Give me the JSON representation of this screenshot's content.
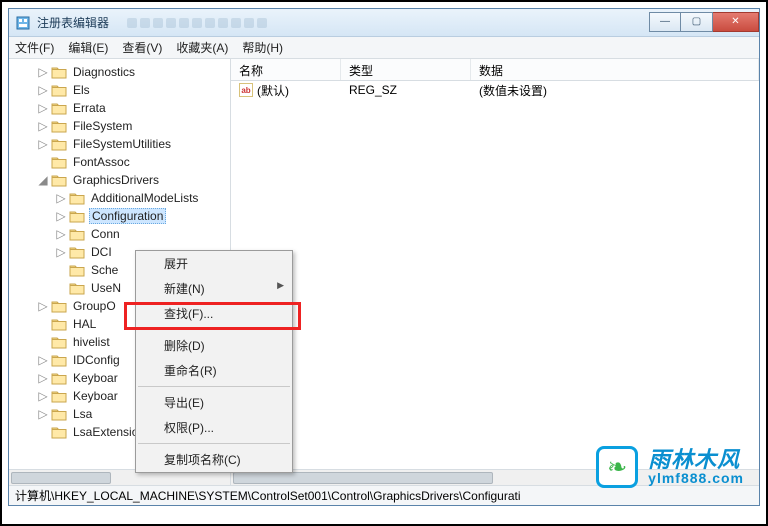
{
  "window": {
    "title": "注册表编辑器"
  },
  "window_controls": {
    "min": "—",
    "max": "▢",
    "close": "✕"
  },
  "menu": {
    "file": "文件(F)",
    "edit": "编辑(E)",
    "view": "查看(V)",
    "favorites": "收藏夹(A)",
    "help": "帮助(H)"
  },
  "tree": {
    "items": [
      {
        "indent": 28,
        "twist": "▷",
        "label": "Diagnostics"
      },
      {
        "indent": 28,
        "twist": "▷",
        "label": "Els"
      },
      {
        "indent": 28,
        "twist": "▷",
        "label": "Errata"
      },
      {
        "indent": 28,
        "twist": "▷",
        "label": "FileSystem"
      },
      {
        "indent": 28,
        "twist": "▷",
        "label": "FileSystemUtilities"
      },
      {
        "indent": 28,
        "twist": "",
        "label": "FontAssoc"
      },
      {
        "indent": 28,
        "twist": "◢",
        "label": "GraphicsDrivers"
      },
      {
        "indent": 46,
        "twist": "▷",
        "label": "AdditionalModeLists"
      },
      {
        "indent": 46,
        "twist": "▷",
        "label": "Configuration",
        "selected": true
      },
      {
        "indent": 46,
        "twist": "▷",
        "label": "Conn"
      },
      {
        "indent": 46,
        "twist": "▷",
        "label": "DCI"
      },
      {
        "indent": 46,
        "twist": "",
        "label": "Sche"
      },
      {
        "indent": 46,
        "twist": "",
        "label": "UseN"
      },
      {
        "indent": 28,
        "twist": "▷",
        "label": "GroupO"
      },
      {
        "indent": 28,
        "twist": "",
        "label": "HAL"
      },
      {
        "indent": 28,
        "twist": "",
        "label": "hivelist"
      },
      {
        "indent": 28,
        "twist": "▷",
        "label": "IDConfig"
      },
      {
        "indent": 28,
        "twist": "▷",
        "label": "Keyboar"
      },
      {
        "indent": 28,
        "twist": "▷",
        "label": "Keyboar"
      },
      {
        "indent": 28,
        "twist": "▷",
        "label": "Lsa"
      },
      {
        "indent": 28,
        "twist": "",
        "label": "LsaExtensionConfig"
      }
    ]
  },
  "list": {
    "headers": {
      "name": "名称",
      "type": "类型",
      "data": "数据"
    },
    "rows": [
      {
        "icon": "ab",
        "name": "(默认)",
        "type": "REG_SZ",
        "data": "(数值未设置)"
      }
    ]
  },
  "context_menu": {
    "items": [
      {
        "label": "展开",
        "kind": "item"
      },
      {
        "label": "新建(N)",
        "kind": "submenu"
      },
      {
        "label": "查找(F)...",
        "kind": "item"
      },
      {
        "kind": "sep"
      },
      {
        "label": "删除(D)",
        "kind": "item"
      },
      {
        "label": "重命名(R)",
        "kind": "item"
      },
      {
        "kind": "sep"
      },
      {
        "label": "导出(E)",
        "kind": "item"
      },
      {
        "label": "权限(P)...",
        "kind": "item"
      },
      {
        "kind": "sep"
      },
      {
        "label": "复制项名称(C)",
        "kind": "item"
      }
    ]
  },
  "status": {
    "path": "计算机\\HKEY_LOCAL_MACHINE\\SYSTEM\\ControlSet001\\Control\\GraphicsDrivers\\Configurati"
  },
  "brand": {
    "cn": "雨林木风",
    "en": "ylmf888.com"
  }
}
